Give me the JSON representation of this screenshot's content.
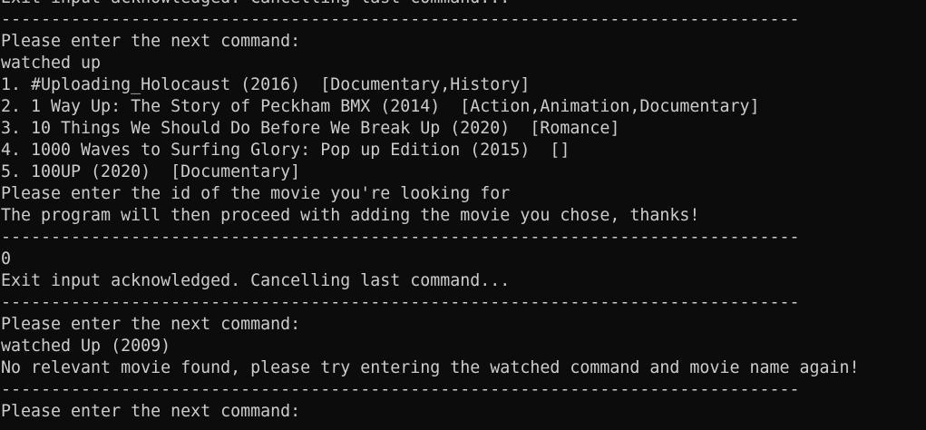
{
  "terminal": {
    "lines": [
      "Exit input acknowledged. Cancelling last command...",
      "--------------------------------------------------------------------------------",
      "Please enter the next command:",
      "watched up",
      "1. #Uploading_Holocaust (2016)  [Documentary,History]",
      "2. 1 Way Up: The Story of Peckham BMX (2014)  [Action,Animation,Documentary]",
      "3. 10 Things We Should Do Before We Break Up (2020)  [Romance]",
      "4. 1000 Waves to Surfing Glory: Pop up Edition (2015)  []",
      "5. 100UP (2020)  [Documentary]",
      "Please enter the id of the movie you're looking for",
      "The program will then proceed with adding the movie you chose, thanks!",
      "--------------------------------------------------------------------------------",
      "0",
      "Exit input acknowledged. Cancelling last command...",
      "--------------------------------------------------------------------------------",
      "Please enter the next command:",
      "watched Up (2009)",
      "No relevant movie found, please try entering the watched command and movie name again!",
      "--------------------------------------------------------------------------------",
      "Please enter the next command:"
    ]
  }
}
